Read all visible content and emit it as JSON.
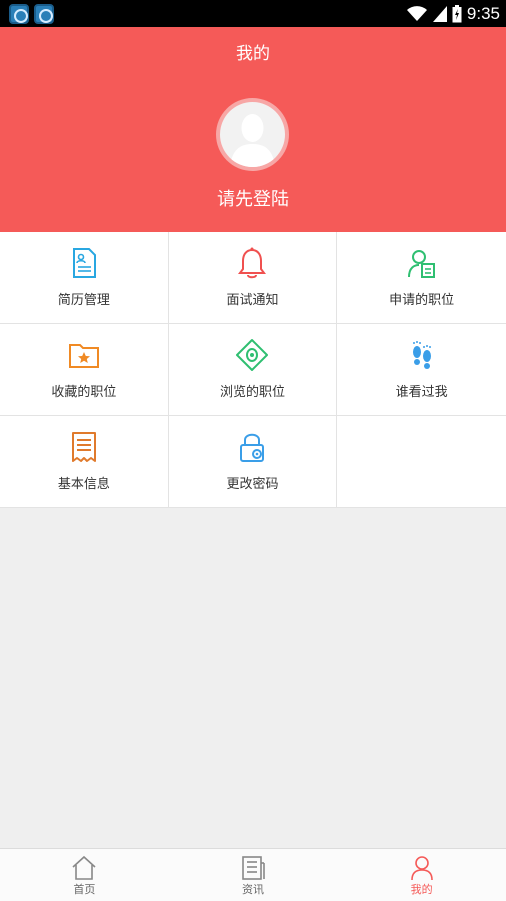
{
  "status_bar": {
    "time": "9:35"
  },
  "header": {
    "title": "我的",
    "login_prompt": "请先登陆"
  },
  "menu": [
    {
      "label": "简历管理",
      "icon": "resume-icon",
      "color": "#29a7e1"
    },
    {
      "label": "面试通知",
      "icon": "bell-icon",
      "color": "#f0504f"
    },
    {
      "label": "申请的职位",
      "icon": "applied-person-icon",
      "color": "#2fbf71"
    },
    {
      "label": "收藏的职位",
      "icon": "folder-star-icon",
      "color": "#f08a24"
    },
    {
      "label": "浏览的职位",
      "icon": "eye-icon",
      "color": "#2fbf71"
    },
    {
      "label": "谁看过我",
      "icon": "footprints-icon",
      "color": "#3a9ee8"
    },
    {
      "label": "基本信息",
      "icon": "receipt-icon",
      "color": "#e07a2c"
    },
    {
      "label": "更改密码",
      "icon": "lock-gear-icon",
      "color": "#3a9ee8"
    }
  ],
  "tabbar": [
    {
      "label": "首页",
      "icon": "home-icon"
    },
    {
      "label": "资讯",
      "icon": "news-icon"
    },
    {
      "label": "我的",
      "icon": "profile-icon",
      "active": true
    }
  ],
  "colors": {
    "accent": "#f55a58",
    "background": "#efefef"
  }
}
